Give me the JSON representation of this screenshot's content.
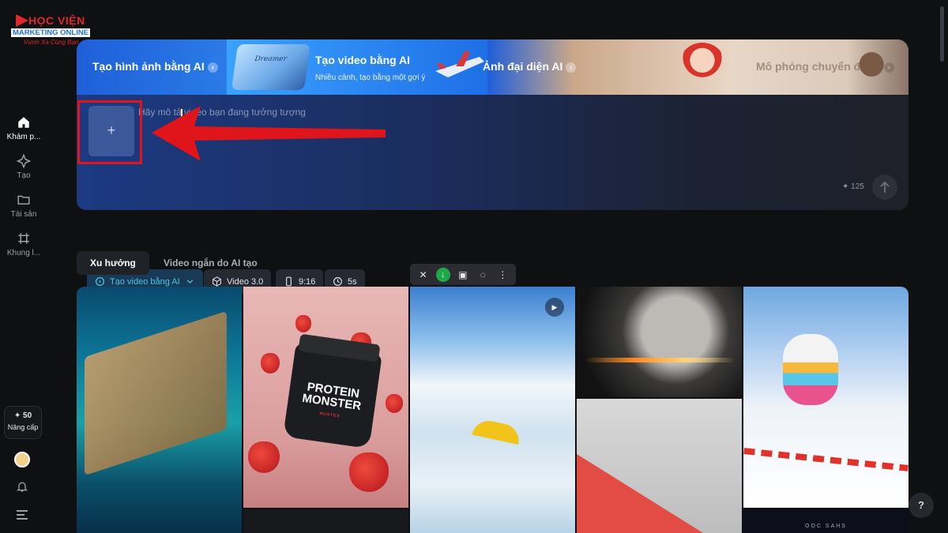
{
  "logo": {
    "line1": "HỌC VIỆN",
    "line2": "MARKETING ONLINE",
    "line3": "Vươn Xa Cùng Bạn"
  },
  "sidebar": {
    "items": [
      {
        "label": "Khám p...",
        "icon": "home-icon"
      },
      {
        "label": "Tạo",
        "icon": "sparkle-icon"
      },
      {
        "label": "Tài sản",
        "icon": "folder-icon"
      },
      {
        "label": "Khung l...",
        "icon": "crop-frame-icon"
      }
    ],
    "upgrade": {
      "credits": "✦ 50",
      "label": "Nâng cấp"
    }
  },
  "banner": {
    "items": [
      {
        "label": "Tạo hình ảnh bằng AI"
      },
      {
        "label": "Tạo video bằng AI",
        "subtitle": "Nhiều cảnh, tạo bằng một gợi ý"
      },
      {
        "label": "Ảnh đại diện AI"
      },
      {
        "label": "Mô phỏng chuyển động"
      }
    ],
    "thumb_caption": "Dreamer"
  },
  "prompt": {
    "placeholder": "Hãy mô tả video bạn đang tưởng tượng",
    "upload_symbol": "+",
    "chips": {
      "mode": "Tạo video bằng AI",
      "model": "Video 3.0",
      "ratio": "9:16",
      "duration": "5s"
    },
    "credit_cost": "✦ 125"
  },
  "tabs": {
    "trending": "Xu hướng",
    "short_videos": "Video ngắn do AI tạo"
  },
  "gallery": {
    "protein_brand": "HUSTEX",
    "protein_title": "PROTEIN MONSTER",
    "bottom_caption": "OOC SAHS"
  },
  "help_label": "?",
  "colors": {
    "accent": "#4fc4e6",
    "highlight_red": "#e0141b",
    "background": "#0f1012"
  }
}
